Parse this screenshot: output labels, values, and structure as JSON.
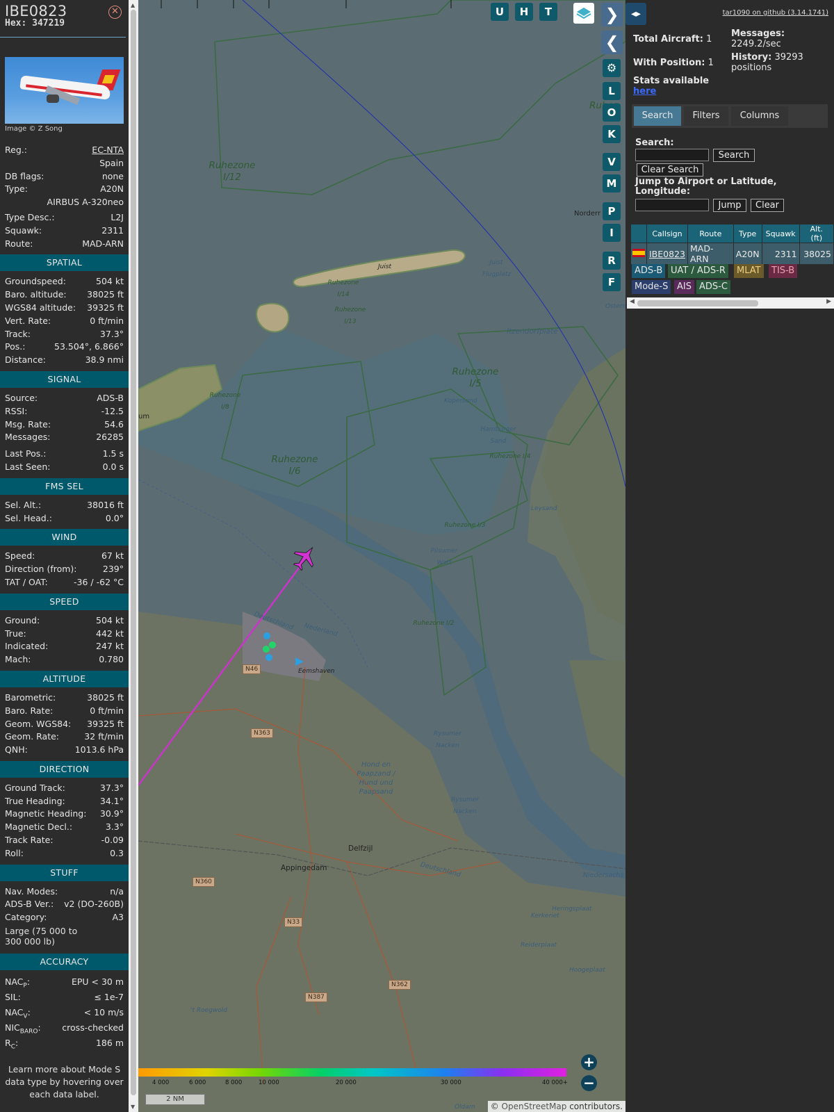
{
  "header": {
    "callsign": "IBE0823",
    "hex": "Hex: 347219",
    "photo_credit": "Image © Z Song"
  },
  "basic": [
    {
      "k": "Reg.:",
      "v": "EC-NTA",
      "link": true
    },
    {
      "k": "",
      "v": "Spain"
    },
    {
      "k": "DB flags:",
      "v": "none"
    },
    {
      "k": "Type:",
      "v": "A20N"
    },
    {
      "k": "",
      "v": "AIRBUS A-320neo"
    },
    {
      "k": "Type Desc.:",
      "v": "L2J"
    },
    {
      "k": "Squawk:",
      "v": "2311"
    },
    {
      "k": "Route:",
      "v": "MAD-ARN"
    }
  ],
  "sections": [
    {
      "title": "SPATIAL",
      "rows": [
        {
          "k": "Groundspeed:",
          "v": "504 kt"
        },
        {
          "k": "Baro. altitude:",
          "v": "38025 ft"
        },
        {
          "k": "WGS84 altitude:",
          "v": "39325 ft"
        },
        {
          "k": "Vert. Rate:",
          "v": "0 ft/min"
        },
        {
          "k": "Track:",
          "v": "37.3°"
        },
        {
          "k": "Pos.:",
          "v": "53.504°, 6.866°"
        },
        {
          "k": "Distance:",
          "v": "38.9 nmi"
        }
      ]
    },
    {
      "title": "SIGNAL",
      "rows": [
        {
          "k": "Source:",
          "v": "ADS-B"
        },
        {
          "k": "RSSI:",
          "v": "-12.5"
        },
        {
          "k": "Msg. Rate:",
          "v": "54.6"
        },
        {
          "k": "Messages:",
          "v": "26285"
        },
        {
          "k": "Last Pos.:",
          "v": "1.5 s"
        },
        {
          "k": "Last Seen:",
          "v": "0.0 s"
        }
      ]
    },
    {
      "title": "FMS SEL",
      "rows": [
        {
          "k": "Sel. Alt.:",
          "v": "38016 ft"
        },
        {
          "k": "Sel. Head.:",
          "v": "0.0°"
        }
      ]
    },
    {
      "title": "WIND",
      "rows": [
        {
          "k": "Speed:",
          "v": "67 kt"
        },
        {
          "k": "Direction (from):",
          "v": "239°"
        },
        {
          "k": "TAT / OAT:",
          "v": "-36 / -62 °C"
        }
      ]
    },
    {
      "title": "SPEED",
      "rows": [
        {
          "k": "Ground:",
          "v": "504 kt"
        },
        {
          "k": "True:",
          "v": "442 kt"
        },
        {
          "k": "Indicated:",
          "v": "247 kt"
        },
        {
          "k": "Mach:",
          "v": "0.780"
        }
      ]
    },
    {
      "title": "ALTITUDE",
      "rows": [
        {
          "k": "Barometric:",
          "v": "38025 ft"
        },
        {
          "k": "Baro. Rate:",
          "v": "0 ft/min"
        },
        {
          "k": "Geom. WGS84:",
          "v": "39325 ft"
        },
        {
          "k": "Geom. Rate:",
          "v": "32 ft/min"
        },
        {
          "k": "QNH:",
          "v": "1013.6 hPa"
        }
      ]
    },
    {
      "title": "DIRECTION",
      "rows": [
        {
          "k": "Ground Track:",
          "v": "37.3°"
        },
        {
          "k": "True Heading:",
          "v": "34.1°"
        },
        {
          "k": "Magnetic Heading:",
          "v": "30.9°"
        },
        {
          "k": "Magnetic Decl.:",
          "v": "3.3°"
        },
        {
          "k": "Track Rate:",
          "v": "-0.09"
        },
        {
          "k": "Roll:",
          "v": "0.3"
        }
      ]
    },
    {
      "title": "STUFF",
      "rows": [
        {
          "k": "Nav. Modes:",
          "v": "n/a"
        },
        {
          "k": "ADS-B Ver.:",
          "v": "v2 (DO-260B)"
        },
        {
          "k": "Category:",
          "v": "A3"
        }
      ]
    }
  ],
  "category_desc": "Large (75 000 to 300 000 lb)",
  "accuracy": {
    "title": "ACCURACY",
    "rows": [
      {
        "k": "NAC",
        "sub": "P",
        "v": "EPU < 30 m"
      },
      {
        "k": "SIL:",
        "sub": "",
        "v": "≤ 1e-7"
      },
      {
        "k": "NAC",
        "sub": "V",
        "v": "< 10 m/s"
      },
      {
        "k": "NIC",
        "sub": "BARO",
        "v": "cross-checked"
      },
      {
        "k": "R",
        "sub": "C",
        "v": "186 m"
      }
    ]
  },
  "footer_note": "Learn more about Mode S data type by hovering over each data label.",
  "map": {
    "top_buttons": [
      "U",
      "H",
      "T"
    ],
    "side_buttons": [
      "L",
      "O",
      "K",
      "V",
      "M",
      "P",
      "I",
      "R",
      "F"
    ],
    "labels": {
      "ruhezone_i12": "Ruhezone I/12",
      "ruhezone_i5": "Ruhezone I/5",
      "ruhezone_i6": "Ruhezone I/6",
      "ruhezone_i14": "Ruhezone I/14",
      "ruhezone_i13": "Ruhezone I/13",
      "ruhezone_i8": "Ruhezone I/8",
      "ruhezone_i4": "Ruhezone I/4",
      "ruhezone_i3": "Ruhezone I/3",
      "ruhezone_i2": "Ruhezone I/2",
      "ruhezone_edge": "Ruhez",
      "juist": "Juist",
      "juist_flugplatz": "Juist Flugplatz",
      "norderney": "Norderr",
      "itzendorfplate": "Itzendorfplate",
      "kopersand": "Kopersand",
      "hamburger_sand": "Hamburger Sand",
      "leysand": "Leysand",
      "pilsumer_watt": "Pilsumer Watt",
      "ostermarsch": "Osterm",
      "borkum_edge": "um",
      "deutschland": "Deutschland",
      "nederland": "Nederland",
      "eemshaven": "Eemshaven",
      "rysumer_nacken1": "Rysumer Nacken",
      "rysumer_nacken2": "Rysumer Nacken",
      "hond_en_paapsand": "Hond en Paapzand / Hund und Paapsand",
      "delfzijl": "Delfzijl",
      "appingedam": "Appingedam",
      "deutschland2": "Deutschland",
      "niedersachsen": "Niedersachs",
      "heringsplaat": "Heringsplaat",
      "kerkeriet": "Kerkeriet",
      "reiderplaat": "Reiderplaat",
      "hoogeplaat": "Hoogeplaat",
      "roegwold": "'t Roegwold",
      "oldam": "Oldam"
    },
    "roads": [
      "N46",
      "N363",
      "N360",
      "N33",
      "N387",
      "N362"
    ],
    "alt_scale": [
      "4 000",
      "6 000",
      "8 000",
      "10 000",
      "20 000",
      "30 000",
      "40 000+"
    ],
    "scale": "2 NM",
    "attribution_symbol": "©",
    "attribution_link": "OpenStreetMap",
    "attribution_rest": "contributors."
  },
  "side": {
    "github": "tar1090 on github (3.14.1741)",
    "total_label": "Total Aircraft:",
    "total_value": "1",
    "position_label": "With Position:",
    "position_value": "1",
    "messages_label": "Messages:",
    "messages_value": "2249.2/sec",
    "history_label": "History:",
    "history_value": "39293 positions",
    "stats_text": "Stats available",
    "stats_link": "here",
    "tabs": [
      "Search",
      "Filters",
      "Columns"
    ],
    "search_label": "Search:",
    "search_button": "Search",
    "clear_search_button": "Clear Search",
    "jump_label": "Jump to Airport or Latitude, Longitude:",
    "jump_button": "Jump",
    "clear_button": "Clear",
    "table_headers": [
      "Callsign",
      "Route",
      "Type",
      "Squawk",
      "Alt. (ft)"
    ],
    "table_row": {
      "callsign": "IBE0823",
      "route": "MAD-ARN",
      "type": "A20N",
      "squawk": "2311",
      "alt": "38025"
    },
    "chips": [
      {
        "label": "ADS-B",
        "color": "#1b5a75"
      },
      {
        "label": "UAT / ADS-R",
        "color": "#2c5a3f"
      },
      {
        "label": "MLAT",
        "color": "#6b5a2a"
      },
      {
        "label": "TIS-B",
        "color": "#6b2a44"
      },
      {
        "label": "Mode-S",
        "color": "#2c3e6b"
      },
      {
        "label": "AIS",
        "color": "#5a2a5a"
      },
      {
        "label": "ADS-C",
        "color": "#2c5a3f"
      }
    ]
  }
}
